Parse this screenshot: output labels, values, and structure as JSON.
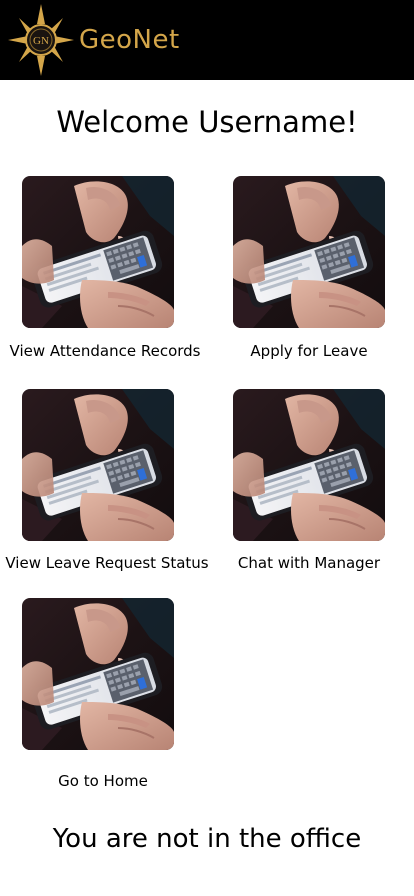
{
  "header": {
    "logo_monogram": "GN",
    "brand_name": "GeoNet",
    "brand_color": "#d4a64a",
    "background_color": "#000000"
  },
  "welcome_text": "Welcome Username!",
  "menu": [
    {
      "label": "View Attendance Records",
      "icon": "phone-photo"
    },
    {
      "label": "Apply for Leave",
      "icon": "phone-photo"
    },
    {
      "label": "View Leave Request Status",
      "icon": "phone-photo"
    },
    {
      "label": "Chat with Manager",
      "icon": "phone-photo"
    },
    {
      "label": "Go to Home",
      "icon": "phone-photo"
    }
  ],
  "status_text": "You are not in the office"
}
